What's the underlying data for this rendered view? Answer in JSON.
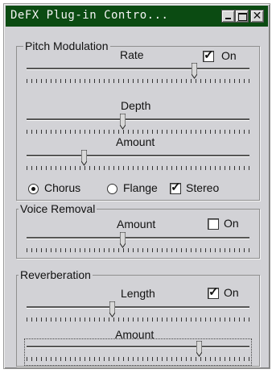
{
  "window": {
    "title": "DeFX Plug-in Contro..."
  },
  "pitch": {
    "legend": "Pitch Modulation",
    "on_label": "On",
    "on_checked": true,
    "rate_label": "Rate",
    "rate_value": 0.76,
    "depth_label": "Depth",
    "depth_value": 0.43,
    "amount_label": "Amount",
    "amount_value": 0.25,
    "mode_options": [
      "Chorus",
      "Flange"
    ],
    "mode_selected": "Chorus",
    "stereo_label": "Stereo",
    "stereo_checked": true
  },
  "voice": {
    "legend": "Voice Removal",
    "on_label": "On",
    "on_checked": false,
    "amount_label": "Amount",
    "amount_value": 0.43
  },
  "reverb": {
    "legend": "Reverberation",
    "on_label": "On",
    "on_checked": true,
    "length_label": "Length",
    "length_value": 0.38,
    "amount_label": "Amount",
    "amount_value": 0.78
  },
  "icons": {
    "minimize": "minimize-icon",
    "maximize": "maximize-icon",
    "close": "close-icon"
  }
}
